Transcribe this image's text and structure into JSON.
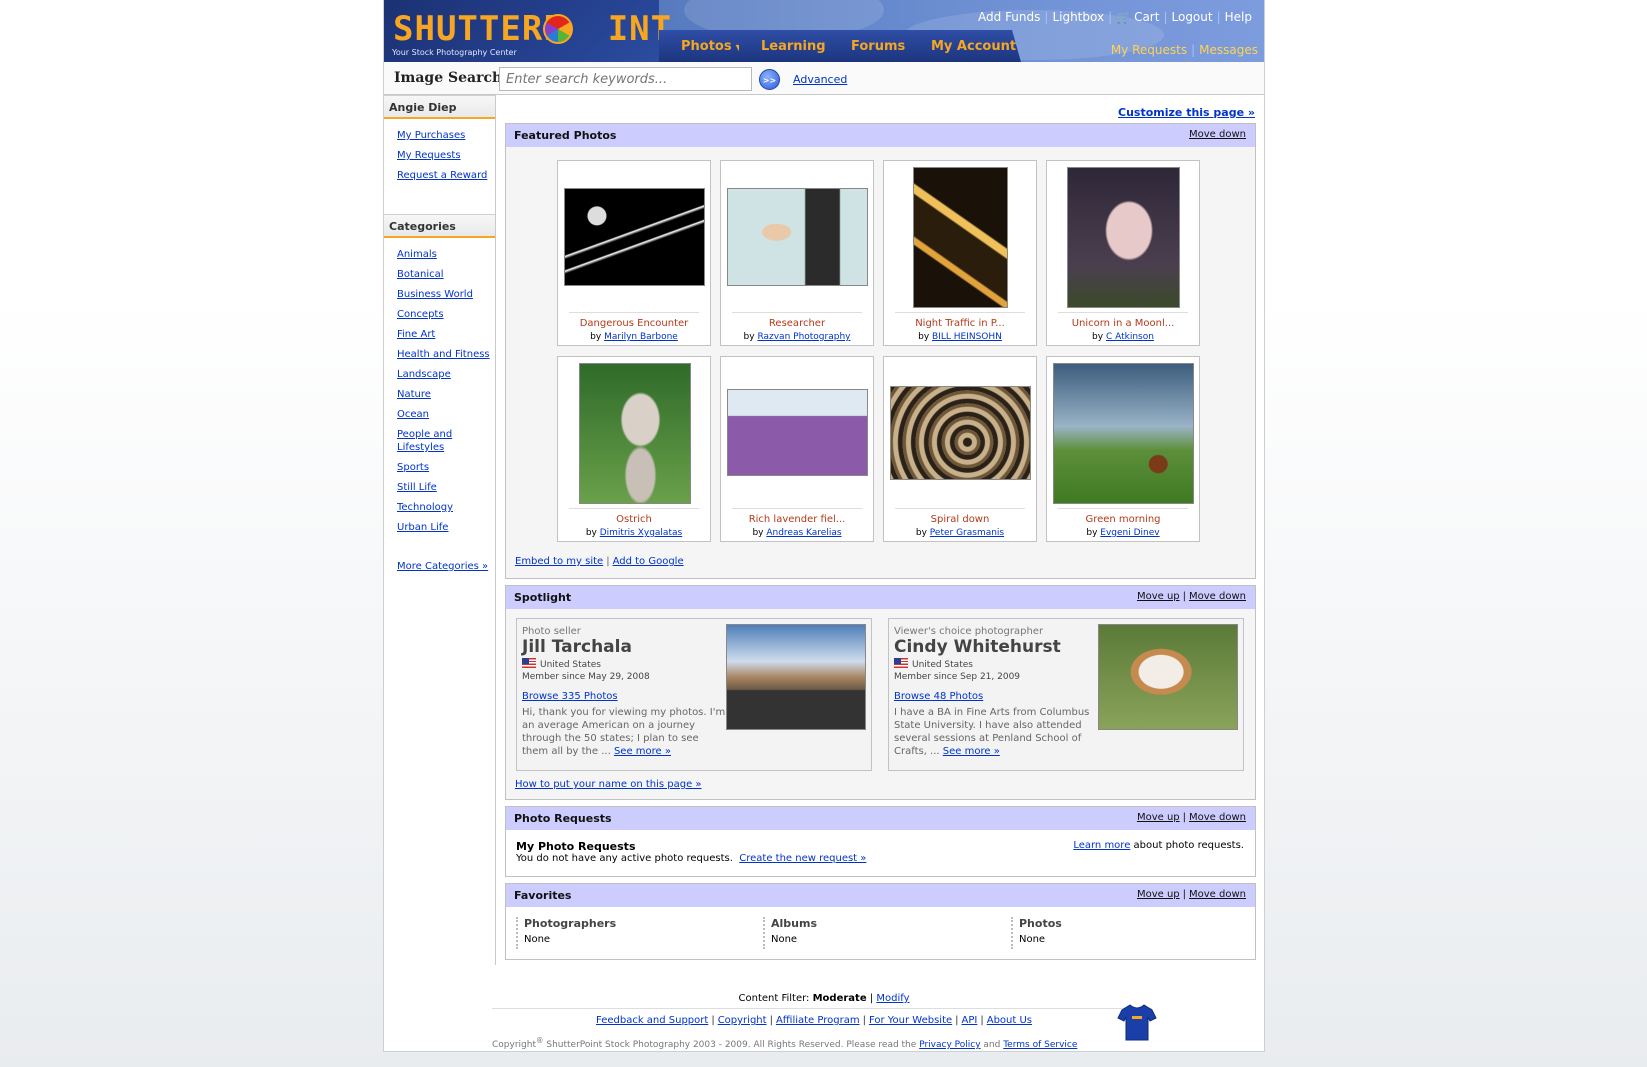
{
  "header": {
    "logo": "SHUTTERPOINT",
    "tagline": "Your Stock Photography Center",
    "tabs": [
      {
        "label": "Photos"
      },
      {
        "label": "Learning"
      },
      {
        "label": "Forums"
      },
      {
        "label": "My Account"
      }
    ],
    "top_links": [
      "Add Funds",
      "Lightbox",
      "Cart",
      "Logout",
      "Help"
    ],
    "sub_links": [
      "My Requests",
      "Messages"
    ]
  },
  "search": {
    "label": "Image Search:",
    "placeholder": "Enter search keywords...",
    "go_label": ">>",
    "advanced": "Advanced"
  },
  "sidebar": {
    "user_name": "Angie Diep",
    "user_links": [
      "My Purchases",
      "My Requests",
      "Request a Reward"
    ],
    "categories_title": "Categories",
    "categories": [
      "Animals",
      "Botanical",
      "Business World",
      "Concepts",
      "Fine Art",
      "Health and Fitness",
      "Landscape",
      "Nature",
      "Ocean",
      "People and Lifestyles",
      "Sports",
      "Still Life",
      "Technology",
      "Urban Life"
    ],
    "more_categories": "More Categories »"
  },
  "main": {
    "customize": "Customize this page »",
    "move_up": "Move up",
    "move_down": "Move down",
    "featured": {
      "title": "Featured Photos",
      "photos": [
        {
          "title": "Dangerous Encounter",
          "by": "by",
          "author": "Marilyn Barbone"
        },
        {
          "title": "Researcher",
          "by": "by",
          "author": "Razvan Photography"
        },
        {
          "title": "Night Traffic in P...",
          "by": "by",
          "author": "BILL HEINSOHN"
        },
        {
          "title": "Unicorn in a Moonl...",
          "by": "by",
          "author": "C Atkinson"
        },
        {
          "title": "Ostrich",
          "by": "by",
          "author": "Dimitris Xygalatas"
        },
        {
          "title": "Rich lavender fiel...",
          "by": "by",
          "author": "Andreas Karelias"
        },
        {
          "title": "Spiral down",
          "by": "by",
          "author": "Peter Grasmanis"
        },
        {
          "title": "Green morning",
          "by": "by",
          "author": "Evgeni Dinev"
        }
      ],
      "embed": "Embed to my site",
      "add_google": "Add to Google"
    },
    "spotlight": {
      "title": "Spotlight",
      "cards": [
        {
          "role": "Photo seller",
          "name": "Jill Tarchala",
          "country": "United States",
          "since": "Member since May 29, 2008",
          "browse": "Browse 335 Photos",
          "bio": "Hi, thank you for viewing my photos. I'm an average American on a journey through the 50 states; I plan to see them all by the ...",
          "see_more": "See more »"
        },
        {
          "role": "Viewer's choice photographer",
          "name": "Cindy Whitehurst",
          "country": "United States",
          "since": "Member since Sep 21, 2009",
          "browse": "Browse 48 Photos",
          "bio": "I have a BA in Fine Arts from Columbus State University. I have also attended several sessions at Penland School of Crafts, ...",
          "see_more": "See more »"
        }
      ],
      "how_to": "How to put your name on this page »"
    },
    "requests": {
      "title": "Photo Requests",
      "subtitle": "My Photo Requests",
      "text": "You do not have any active photo requests.",
      "create": "Create the new request »",
      "learn_more": "Learn more",
      "learn_more_suffix": "about photo requests."
    },
    "favorites": {
      "title": "Favorites",
      "columns": [
        {
          "title": "Photographers",
          "value": "None"
        },
        {
          "title": "Albums",
          "value": "None"
        },
        {
          "title": "Photos",
          "value": "None"
        }
      ]
    }
  },
  "footer": {
    "filter_label": "Content Filter:",
    "filter_value": "Moderate",
    "modify": "Modify",
    "links": [
      "Feedback and Support",
      "Copyright",
      "Affiliate Program",
      "For Your Website",
      "API",
      "About Us"
    ],
    "copyright_prefix": "Copyright",
    "copyright_mark": "®",
    "copyright_text": "ShutterPoint Stock Photography 2003 - 2009. All Rights Reserved. Please read the",
    "privacy": "Privacy Policy",
    "and": "and",
    "terms": "Terms of Service"
  },
  "colors": {
    "header_blue": "#4a6aa8",
    "logo_orange": "#f6a623",
    "panel_header": "#ccccff",
    "link": "#0033cc",
    "photo_title": "#b33a1a"
  }
}
